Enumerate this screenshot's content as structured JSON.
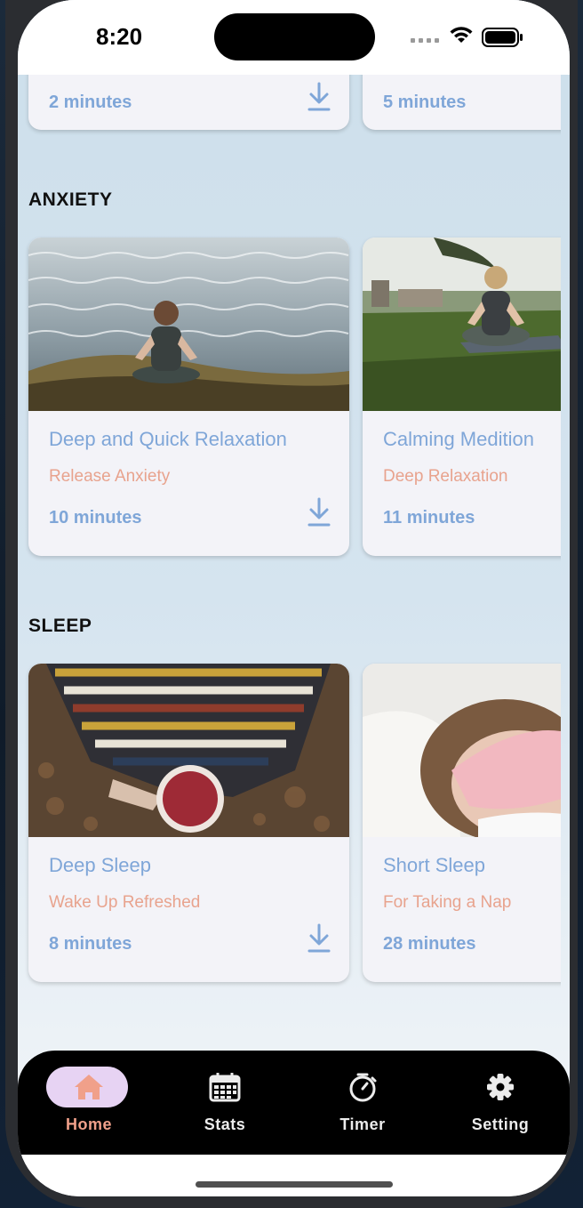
{
  "status": {
    "time": "8:20"
  },
  "top_row": [
    {
      "duration": "2 minutes"
    },
    {
      "duration": "5 minutes"
    }
  ],
  "sections": [
    {
      "title": "ANXIETY",
      "cards": [
        {
          "title": "Deep and Quick Relaxation",
          "subtitle": "Release Anxiety",
          "duration": "10 minutes"
        },
        {
          "title": "Calming Medition",
          "subtitle": "Deep Relaxation",
          "duration": "11 minutes"
        }
      ]
    },
    {
      "title": "SLEEP",
      "cards": [
        {
          "title": "Deep Sleep",
          "subtitle": "Wake Up Refreshed",
          "duration": "8 minutes"
        },
        {
          "title": "Short Sleep",
          "subtitle": "For Taking a Nap",
          "duration": "28 minutes"
        }
      ]
    }
  ],
  "tabs": [
    {
      "label": "Home",
      "icon": "home-icon",
      "active": true
    },
    {
      "label": "Stats",
      "icon": "calendar-icon",
      "active": false
    },
    {
      "label": "Timer",
      "icon": "stopwatch-icon",
      "active": false
    },
    {
      "label": "Setting",
      "icon": "gear-icon",
      "active": false
    }
  ],
  "colors": {
    "title_blue": "#7fa6d8",
    "subtitle_salmon": "#e8a38e",
    "active_tab": "#f0a08a",
    "active_pill": "#e7d3f3"
  }
}
